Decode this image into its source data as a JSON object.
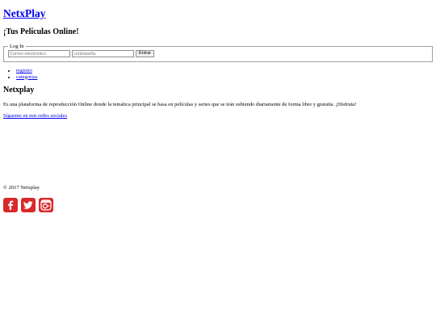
{
  "header": {
    "site_name": "NetxPlay",
    "tagline": "¡Tus Películas Online!"
  },
  "login": {
    "legend": "Log In",
    "email_placeholder": "Correo electronico",
    "password_placeholder": "contraseña",
    "submit_label": "Entrar"
  },
  "nav": {
    "items": [
      {
        "label": "registro"
      },
      {
        "label": "categorias"
      }
    ]
  },
  "about": {
    "title": "Netxplay",
    "text": "Es una plataforma de reproducción Online donde la temática principal se basa en películas y series que se irán subiendo diariamente de forma libre y gratuita. ¡Disfruta!",
    "social_link": "Sígueme en mis redes sociales"
  },
  "footer": {
    "copyright": "© 2017 Netxplay"
  },
  "social": {
    "icons": [
      "facebook-icon",
      "twitter-icon",
      "instagram-icon"
    ],
    "color": "#d9292a"
  }
}
